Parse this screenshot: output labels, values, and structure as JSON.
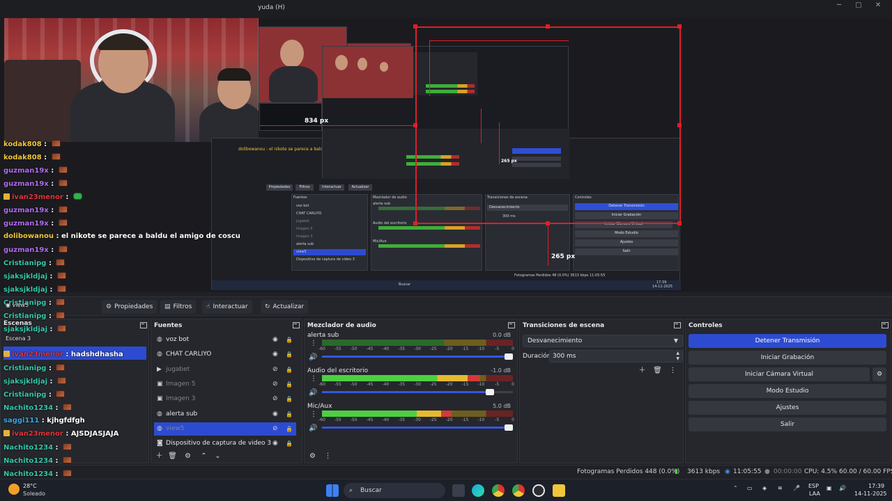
{
  "window": {
    "menu_fragment": "yuda (H)"
  },
  "preview": {
    "measure_width": "834 px",
    "measure_height_a": "265 px",
    "measure_height_b": "265 px"
  },
  "nested": {
    "chat_line": "dolibowanou : el nikote se parece a baldu el amigo de coscu",
    "toolbar": [
      "Propiedades",
      "Filtros",
      "Interactuar",
      "Actualizar"
    ],
    "fuentes_title": "Fuentes",
    "mixer_title": "Mezclador de audio",
    "trans_title": "Transiciones de escena",
    "ctrl_title": "Controles",
    "sources": [
      "voz bot",
      "CHAT CARLIYO",
      "jugabet",
      "Imagen 5",
      "Imagen 3",
      "alerta sub",
      "view5",
      "Dispositivo de captura de video 3"
    ],
    "mixer_channels": [
      "alerta sub",
      "Audio del escritorio",
      "Mic/Aux"
    ],
    "trans_select": "Desvanecimiento",
    "duration": "300 ms",
    "controls": [
      "Detener Transmisión",
      "Iniciar Grabación",
      "Iniciar Cámara Virtual",
      "Modo Estudio",
      "Ajustes",
      "Salir"
    ],
    "status": "Fotogramas Perdidos 48 (0.0%)   3613 kbps   11:05:55",
    "search": "Buscar",
    "clock": "17:39",
    "date": "14-11-2025",
    "scene_row": "hadshdhasha",
    "chat_extra": [
      "saggi111 : kjhgfdfgh",
      "ivan23menor : AJSDJASJAJA",
      "Nachito1234 :"
    ]
  },
  "chat": [
    {
      "user": "kodak808",
      "color": "#f0c63a",
      "msg": "",
      "emote": "brown",
      "badge": false
    },
    {
      "user": "kodak808",
      "color": "#f0c63a",
      "msg": "",
      "emote": "brown",
      "badge": false
    },
    {
      "user": "guzman19x",
      "color": "#b06cf0",
      "msg": "",
      "emote": "brown",
      "badge": false
    },
    {
      "user": "guzman19x",
      "color": "#b06cf0",
      "msg": "",
      "emote": "brown",
      "badge": false
    },
    {
      "user": "ivan23menor",
      "color": "#e0343a",
      "msg": "",
      "emote": "green",
      "badge": true
    },
    {
      "user": "guzman19x",
      "color": "#b06cf0",
      "msg": "",
      "emote": "brown",
      "badge": false
    },
    {
      "user": "guzman19x",
      "color": "#b06cf0",
      "msg": "",
      "emote": "brown",
      "badge": false
    },
    {
      "user": "dolibowanou",
      "color": "#f0c63a",
      "msg": "el nikote se parece a baldu el amigo de coscu",
      "emote": "",
      "badge": false
    },
    {
      "user": "guzman19x",
      "color": "#b06cf0",
      "msg": "",
      "emote": "brown",
      "badge": false
    },
    {
      "user": "Cristianipg",
      "color": "#34c7a8",
      "msg": "",
      "emote": "brown",
      "badge": false
    },
    {
      "user": "sjaksjkldjaj",
      "color": "#34c7a8",
      "msg": "",
      "emote": "brown",
      "badge": false
    },
    {
      "user": "sjaksjkldjaj",
      "color": "#34c7a8",
      "msg": "",
      "emote": "brown",
      "badge": false
    },
    {
      "user": "Cristianipg",
      "color": "#34c7a8",
      "msg": "",
      "emote": "brown",
      "badge": false
    },
    {
      "user": "Cristianipg",
      "color": "#34c7a8",
      "msg": "",
      "emote": "brown",
      "badge": false
    },
    {
      "user": "sjaksjkldjaj",
      "color": "#34c7a8",
      "msg": "",
      "emote": "brown",
      "badge": false
    },
    {
      "user": "ivan23menor",
      "color": "#e0343a",
      "msg": "hadshdhasha",
      "emote": "",
      "badge": true
    },
    {
      "user": "Cristianipg",
      "color": "#34c7a8",
      "msg": "",
      "emote": "brown",
      "badge": false
    },
    {
      "user": "sjaksjkldjaj",
      "color": "#34c7a8",
      "msg": "",
      "emote": "brown",
      "badge": false
    },
    {
      "user": "Cristianipg",
      "color": "#34c7a8",
      "msg": "",
      "emote": "brown",
      "badge": false
    },
    {
      "user": "Nachito1234",
      "color": "#34c7a8",
      "msg": "",
      "emote": "brown",
      "badge": false
    },
    {
      "user": "saggi111",
      "color": "#34a7e0",
      "msg": "kjhgfdfgh",
      "emote": "",
      "badge": false
    },
    {
      "user": "ivan23menor",
      "color": "#e0343a",
      "msg": "AJSDJASJAJA",
      "emote": "",
      "badge": true
    },
    {
      "user": "Nachito1234",
      "color": "#34c7a8",
      "msg": "",
      "emote": "brown",
      "badge": false
    },
    {
      "user": "Nachito1234",
      "color": "#34c7a8",
      "msg": "",
      "emote": "brown",
      "badge": false
    },
    {
      "user": "Nachito1234",
      "color": "#34c7a8",
      "msg": "",
      "emote": "brown",
      "badge": false
    }
  ],
  "scenes_overlay": {
    "label": "Escenas",
    "scene3": "Escena 3",
    "view5": "view5"
  },
  "context_bar": {
    "propiedades": "Propiedades",
    "filtros": "Filtros",
    "interactuar": "Interactuar",
    "actualizar": "Actualizar"
  },
  "fuentes": {
    "title": "Fuentes",
    "items": [
      {
        "label": "voz bot",
        "icon": "globe-icon",
        "visible": true,
        "dim": false,
        "selected": false
      },
      {
        "label": "CHAT CARLIYO",
        "icon": "globe-icon",
        "visible": true,
        "dim": false,
        "selected": false
      },
      {
        "label": "jugabet",
        "icon": "play-icon",
        "visible": false,
        "dim": true,
        "selected": false
      },
      {
        "label": "Imagen 5",
        "icon": "image-icon",
        "visible": false,
        "dim": true,
        "selected": false
      },
      {
        "label": "Imagen 3",
        "icon": "image-icon",
        "visible": false,
        "dim": true,
        "selected": false
      },
      {
        "label": "alerta sub",
        "icon": "globe-icon",
        "visible": true,
        "dim": false,
        "selected": false
      },
      {
        "label": "view5",
        "icon": "globe-icon",
        "visible": false,
        "dim": true,
        "selected": true
      },
      {
        "label": "Dispositivo de captura de video 3",
        "icon": "camera-icon",
        "visible": true,
        "dim": false,
        "selected": false
      }
    ]
  },
  "mixer": {
    "title": "Mezclador de audio",
    "scale": [
      "-60",
      "-55",
      "-50",
      "-45",
      "-40",
      "-35",
      "-30",
      "-25",
      "-20",
      "-15",
      "-10",
      "-5",
      "0"
    ],
    "channels": [
      {
        "name": "alerta sub",
        "db": "0.0 dB",
        "level": 0.0,
        "volume": 1.0
      },
      {
        "name": "Audio del escritorio",
        "db": "-1.0 dB",
        "level": 0.83,
        "volume": 0.9
      },
      {
        "name": "Mic/Aux",
        "db": "5.0 dB",
        "level": 0.68,
        "volume": 1.0
      }
    ]
  },
  "transitions": {
    "title": "Transiciones de escena",
    "selected": "Desvanecimiento",
    "duration_label": "Duración",
    "duration_value": "300 ms"
  },
  "controls": {
    "title": "Controles",
    "stop_stream": "Detener Transmisión",
    "start_recording": "Iniciar Grabación",
    "virtual_cam": "Iniciar Cámara Virtual",
    "studio_mode": "Modo Estudio",
    "settings": "Ajustes",
    "exit": "Salir"
  },
  "status": {
    "dropped_frames": "Fotogramas Perdidos 448 (0.0%)",
    "bitrate": "3613 kbps",
    "stream_time": "11:05:55",
    "rec_time": "00:00:00",
    "cpu": "CPU: 4.5%",
    "fps": "60.00 / 60.00 FPS"
  },
  "taskbar": {
    "weather_temp": "28°C",
    "weather_desc": "Soleado",
    "search": "Buscar",
    "lang": "ESP",
    "lang_sub": "LAA",
    "time": "17:39",
    "date": "14-11-2025"
  },
  "colors": {
    "accent": "#2d4bd1",
    "selection_red": "#e01e28"
  }
}
